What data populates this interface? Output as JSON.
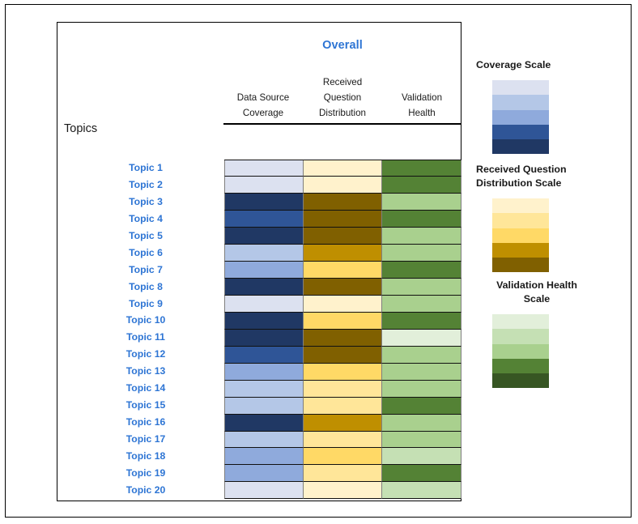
{
  "header": {
    "overall_title": "Overall",
    "columns": [
      {
        "name": "data-source-coverage",
        "lines": [
          "Data Source",
          "Coverage"
        ]
      },
      {
        "name": "received-question-distribution",
        "lines": [
          "Received",
          "Question",
          "Distribution"
        ]
      },
      {
        "name": "validation-health",
        "lines": [
          "Validation",
          "Health"
        ]
      }
    ]
  },
  "topics_axis_label": "Topics",
  "topics": [
    "Topic 1",
    "Topic 2",
    "Topic 3",
    "Topic 4",
    "Topic 5",
    "Topic 6",
    "Topic 7",
    "Topic 8",
    "Topic 9",
    "Topic 10",
    "Topic 11",
    "Topic 12",
    "Topic 13",
    "Topic 14",
    "Topic 15",
    "Topic 16",
    "Topic 17",
    "Topic 18",
    "Topic 19",
    "Topic 20"
  ],
  "scales": {
    "coverage": {
      "title": "Coverage Scale",
      "colors": [
        "#dce1f0",
        "#b4c7e7",
        "#8faadc",
        "#2f5597",
        "#203864"
      ]
    },
    "received_question_distribution": {
      "title_lines": [
        "Received Question",
        "Distribution Scale"
      ],
      "colors": [
        "#fff2cc",
        "#ffe699",
        "#ffd966",
        "#bf8f00",
        "#806000"
      ]
    },
    "validation_health": {
      "title_lines": [
        "Validation Health",
        "Scale"
      ],
      "colors": [
        "#e2efda",
        "#c5e0b4",
        "#a9d08e",
        "#548235",
        "#375623"
      ]
    }
  },
  "band_color": "#fcefd3",
  "accent_color": "#2e75d4",
  "chart_data": {
    "type": "heatmap",
    "title": "Overall",
    "xlabel": "",
    "ylabel": "Topics",
    "grid": true,
    "legend_position": "right",
    "columns": [
      "Data Source Coverage",
      "Received Question Distribution",
      "Validation Health"
    ],
    "rows": [
      "Topic 1",
      "Topic 2",
      "Topic 3",
      "Topic 4",
      "Topic 5",
      "Topic 6",
      "Topic 7",
      "Topic 8",
      "Topic 9",
      "Topic 10",
      "Topic 11",
      "Topic 12",
      "Topic 13",
      "Topic 14",
      "Topic 15",
      "Topic 16",
      "Topic 17",
      "Topic 18",
      "Topic 19",
      "Topic 20"
    ],
    "level_scale": [
      1,
      2,
      3,
      4,
      5
    ],
    "series": [
      {
        "name": "Data Source Coverage",
        "palette": [
          "#dce1f0",
          "#b4c7e7",
          "#8faadc",
          "#2f5597",
          "#203864"
        ],
        "levels": [
          1,
          1,
          5,
          4,
          5,
          2,
          3,
          5,
          1,
          5,
          5,
          4,
          3,
          2,
          2,
          5,
          2,
          3,
          3,
          1
        ]
      },
      {
        "name": "Received Question Distribution",
        "palette": [
          "#fff2cc",
          "#ffe699",
          "#ffd966",
          "#bf8f00",
          "#806000"
        ],
        "levels": [
          1,
          1,
          5,
          5,
          5,
          4,
          3,
          5,
          1,
          3,
          5,
          5,
          3,
          2,
          2,
          4,
          2,
          3,
          2,
          1
        ]
      },
      {
        "name": "Validation Health",
        "palette": [
          "#e2efda",
          "#c5e0b4",
          "#a9d08e",
          "#548235",
          "#375623"
        ],
        "levels": [
          4,
          4,
          3,
          4,
          3,
          3,
          4,
          3,
          3,
          4,
          1,
          3,
          3,
          3,
          4,
          3,
          3,
          2,
          4,
          2
        ]
      }
    ],
    "cell_colors": [
      [
        "#dce1f0",
        "#fff2cc",
        "#548235"
      ],
      [
        "#dce1f0",
        "#fff2cc",
        "#548235"
      ],
      [
        "#203864",
        "#806000",
        "#a9d08e"
      ],
      [
        "#2f5597",
        "#806000",
        "#548235"
      ],
      [
        "#203864",
        "#806000",
        "#a9d08e"
      ],
      [
        "#b4c7e7",
        "#bf8f00",
        "#a9d08e"
      ],
      [
        "#8faadc",
        "#ffd966",
        "#548235"
      ],
      [
        "#203864",
        "#806000",
        "#a9d08e"
      ],
      [
        "#dce1f0",
        "#fff2cc",
        "#a9d08e"
      ],
      [
        "#203864",
        "#ffd966",
        "#548235"
      ],
      [
        "#203864",
        "#806000",
        "#e2efda"
      ],
      [
        "#2f5597",
        "#806000",
        "#a9d08e"
      ],
      [
        "#8faadc",
        "#ffd966",
        "#a9d08e"
      ],
      [
        "#b4c7e7",
        "#ffe699",
        "#a9d08e"
      ],
      [
        "#b4c7e7",
        "#ffe699",
        "#548235"
      ],
      [
        "#203864",
        "#bf8f00",
        "#a9d08e"
      ],
      [
        "#b4c7e7",
        "#ffe699",
        "#a9d08e"
      ],
      [
        "#8faadc",
        "#ffd966",
        "#c5e0b4"
      ],
      [
        "#8faadc",
        "#ffe699",
        "#548235"
      ],
      [
        "#dce1f0",
        "#fff2cc",
        "#c5e0b4"
      ]
    ]
  }
}
